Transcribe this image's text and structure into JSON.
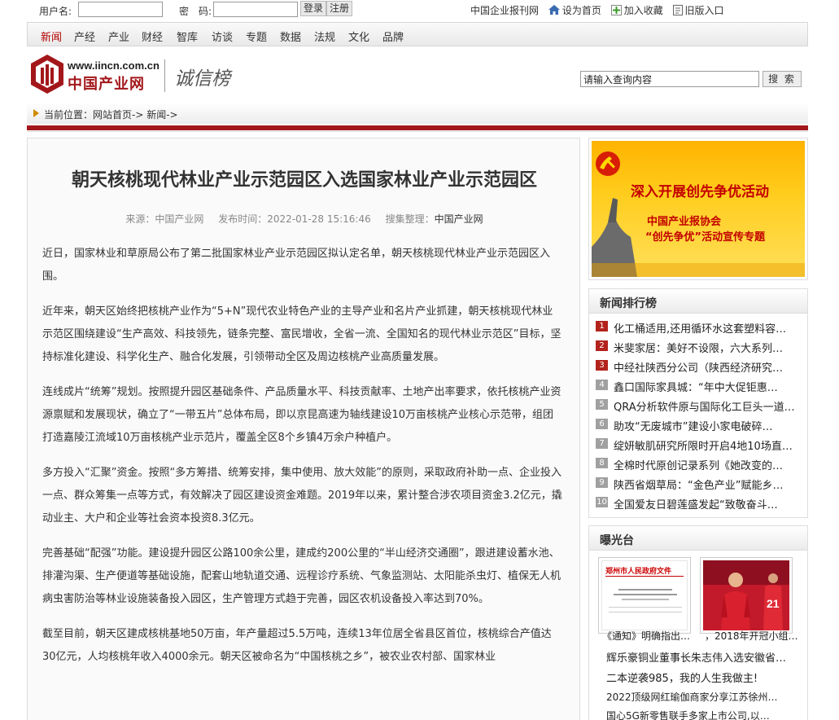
{
  "topbar": {
    "username_label": "用户名:",
    "password_label": "密　码:",
    "login": "登录",
    "register": "注册",
    "links": [
      "中国企业报刊网",
      "设为首页",
      "加入收藏",
      "旧版入口"
    ]
  },
  "nav": [
    "新闻",
    "产经",
    "产业",
    "财经",
    "智库",
    "访谈",
    "专题",
    "数据",
    "法规",
    "文化",
    "品牌"
  ],
  "header": {
    "logo_url": "www.iincn.com.cn",
    "logo_name": "中国产业网",
    "channel": "诚信榜",
    "search_value": "请输入查询内容",
    "search_button": "搜 索"
  },
  "breadcrumb": "当前位置：网站首页-> 新闻->",
  "article": {
    "title": "朝天核桃现代林业产业示范园区入选国家林业产业示范园区",
    "source_label": "来源：",
    "source": "中国产业网",
    "time_label": "发布时间：",
    "time": "2022-01-28 15:16:46",
    "editor_label": "搜集整理：",
    "editor": "中国产业网",
    "paragraphs": [
      "近日，国家林业和草原局公布了第二批国家林业产业示范园区拟认定名单，朝天核桃现代林业产业示范园区入围。",
      "近年来，朝天区始终把核桃产业作为“5+N”现代农业特色产业的主导产业和名片产业抓建，朝天核桃现代林业示范区围绕建设“生产高效、科技领先，链条完整、富民增收，全省一流、全国知名的现代林业示范区”目标，坚持标准化建设、科学化生产、融合化发展，引领带动全区及周边核桃产业高质量发展。",
      "连线成片“统筹”规划。按照提升园区基础条件、产品质量水平、科技贡献率、土地产出率要求，依托核桃产业资源禀赋和发展现状，确立了“一带五片”总体布局，即以京昆高速为轴线建设10万亩核桃产业核心示范带，组团打造嘉陵江流域10万亩核桃产业示范片，覆盖全区8个乡镇4万余户种植户。",
      "多方投入“汇聚”资金。按照“多方筹措、统筹安排，集中使用、放大效能”的原则，采取政府补助一点、企业投入一点、群众筹集一点等方式，有效解决了园区建设资金难题。2019年以来，累计整合涉农项目资金3.2亿元，撬动业主、大户和企业等社会资本投资8.3亿元。",
      "完善基础“配强”功能。建设提升园区公路100余公里，建成约200公里的“半山经济交通圈”，跟进建设蓄水池、排灌沟渠、生产便道等基础设施，配套山地轨道交通、远程诊疗系统、气象监测站、太阳能杀虫灯、植保无人机病虫害防治等林业设施装备投入园区，生产管理方式趋于完善，园区农机设备投入率达到70%。",
      "截至目前，朝天区建成核桃基地50万亩，年产量超过5.5万吨，连续13年位居全省县区首位，核桃综合产值达30亿元，人均核桃年收入4000余元。朝天区被命名为“中国核桃之乡”，被农业农村部、国家林业"
    ]
  },
  "banner": {
    "line1": "深入开展创先争优活动",
    "line2": "中国产业报协会",
    "line3": "“创先争优”活动宣传专题"
  },
  "ranking": {
    "title": "新闻排行榜",
    "items": [
      "化工桶适用,还用循环水这套塑料容…",
      "米斐家居：美好不设限，六大系列…",
      "中经社陕西分公司（陕西经济研究…",
      "鑫口国际家具城：“年中大促钜惠…",
      "QRA分析软件原与国际化工巨头一道…",
      "助攻“无废城市”建设小家电破碎…",
      "绽妍敏肌研究所限时开启4地10场直…",
      "全棉时代原创记录系列《她改变的…",
      "陕西省烟草局：“金色产业”赋能乡…",
      "全国爱友日碧莲盛发起“致敬奋斗…"
    ],
    "numbers": [
      "1",
      "2",
      "3",
      "4",
      "5",
      "6",
      "7",
      "8",
      "9",
      "10"
    ]
  },
  "exposure": {
    "title": "曝光台",
    "doc_heading": "郑州市人民政府文件",
    "captions": [
      "《通知》明确指出…",
      "，2018年开冠小组…"
    ],
    "items": [
      "辉乐豪铜业董事长朱志伟入选安徽省…",
      "二本逆袭985，我的人生我做主!",
      "2022顶级网红瑜伽商家分享江苏徐州…",
      "国心5G新零售联手多家上市公司,以…"
    ]
  },
  "colors": {
    "brand_red": "#a3171b",
    "nav_active": "#b30000",
    "rank_hot": "#b3231c",
    "rank_normal": "#a0a0a0"
  }
}
